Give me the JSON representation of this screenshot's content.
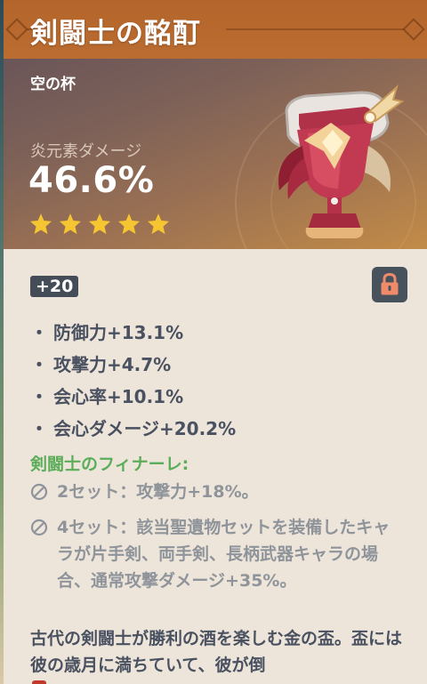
{
  "artifact": {
    "title": "剣闘士の酩酊",
    "slot_type": "空の杯",
    "main_stat": {
      "name": "炎元素ダメージ",
      "value": "46.6%"
    },
    "rarity_stars": 5,
    "level": "+20",
    "locked": true,
    "sub_stats": [
      {
        "bullet": "・",
        "text": "防御力+13.1%"
      },
      {
        "bullet": "・",
        "text": "攻撃力+4.7%"
      },
      {
        "bullet": "・",
        "text": "会心率+10.1%"
      },
      {
        "bullet": "・",
        "text": "会心ダメージ+20.2%"
      }
    ],
    "set_name": "剣闘士のフィナーレ:",
    "set_bonuses": [
      {
        "text": "2セット：攻撃力+18%。"
      },
      {
        "text": "4セット：該当聖遺物セットを装備したキャラが片手剣、両手剣、長柄武器キャラの場合、通常攻撃ダメージ+35%。"
      }
    ],
    "lore": "古代の剣闘士が勝利の酒を楽しむ金の盃。盃には彼の歳月に満ちていて、彼が倒"
  },
  "colors": {
    "title_bar": "#b96a2e",
    "set_name_green": "#5cad5a",
    "star_gold": "#f6c532",
    "text_dark": "#4a5160",
    "text_muted": "#8f949a",
    "panel_bg": "#ede5da"
  },
  "icons": {
    "star": "star-icon",
    "lock": "lock-icon",
    "inactive_set": "prohibited-icon",
    "artifact": "goblet-icon"
  }
}
